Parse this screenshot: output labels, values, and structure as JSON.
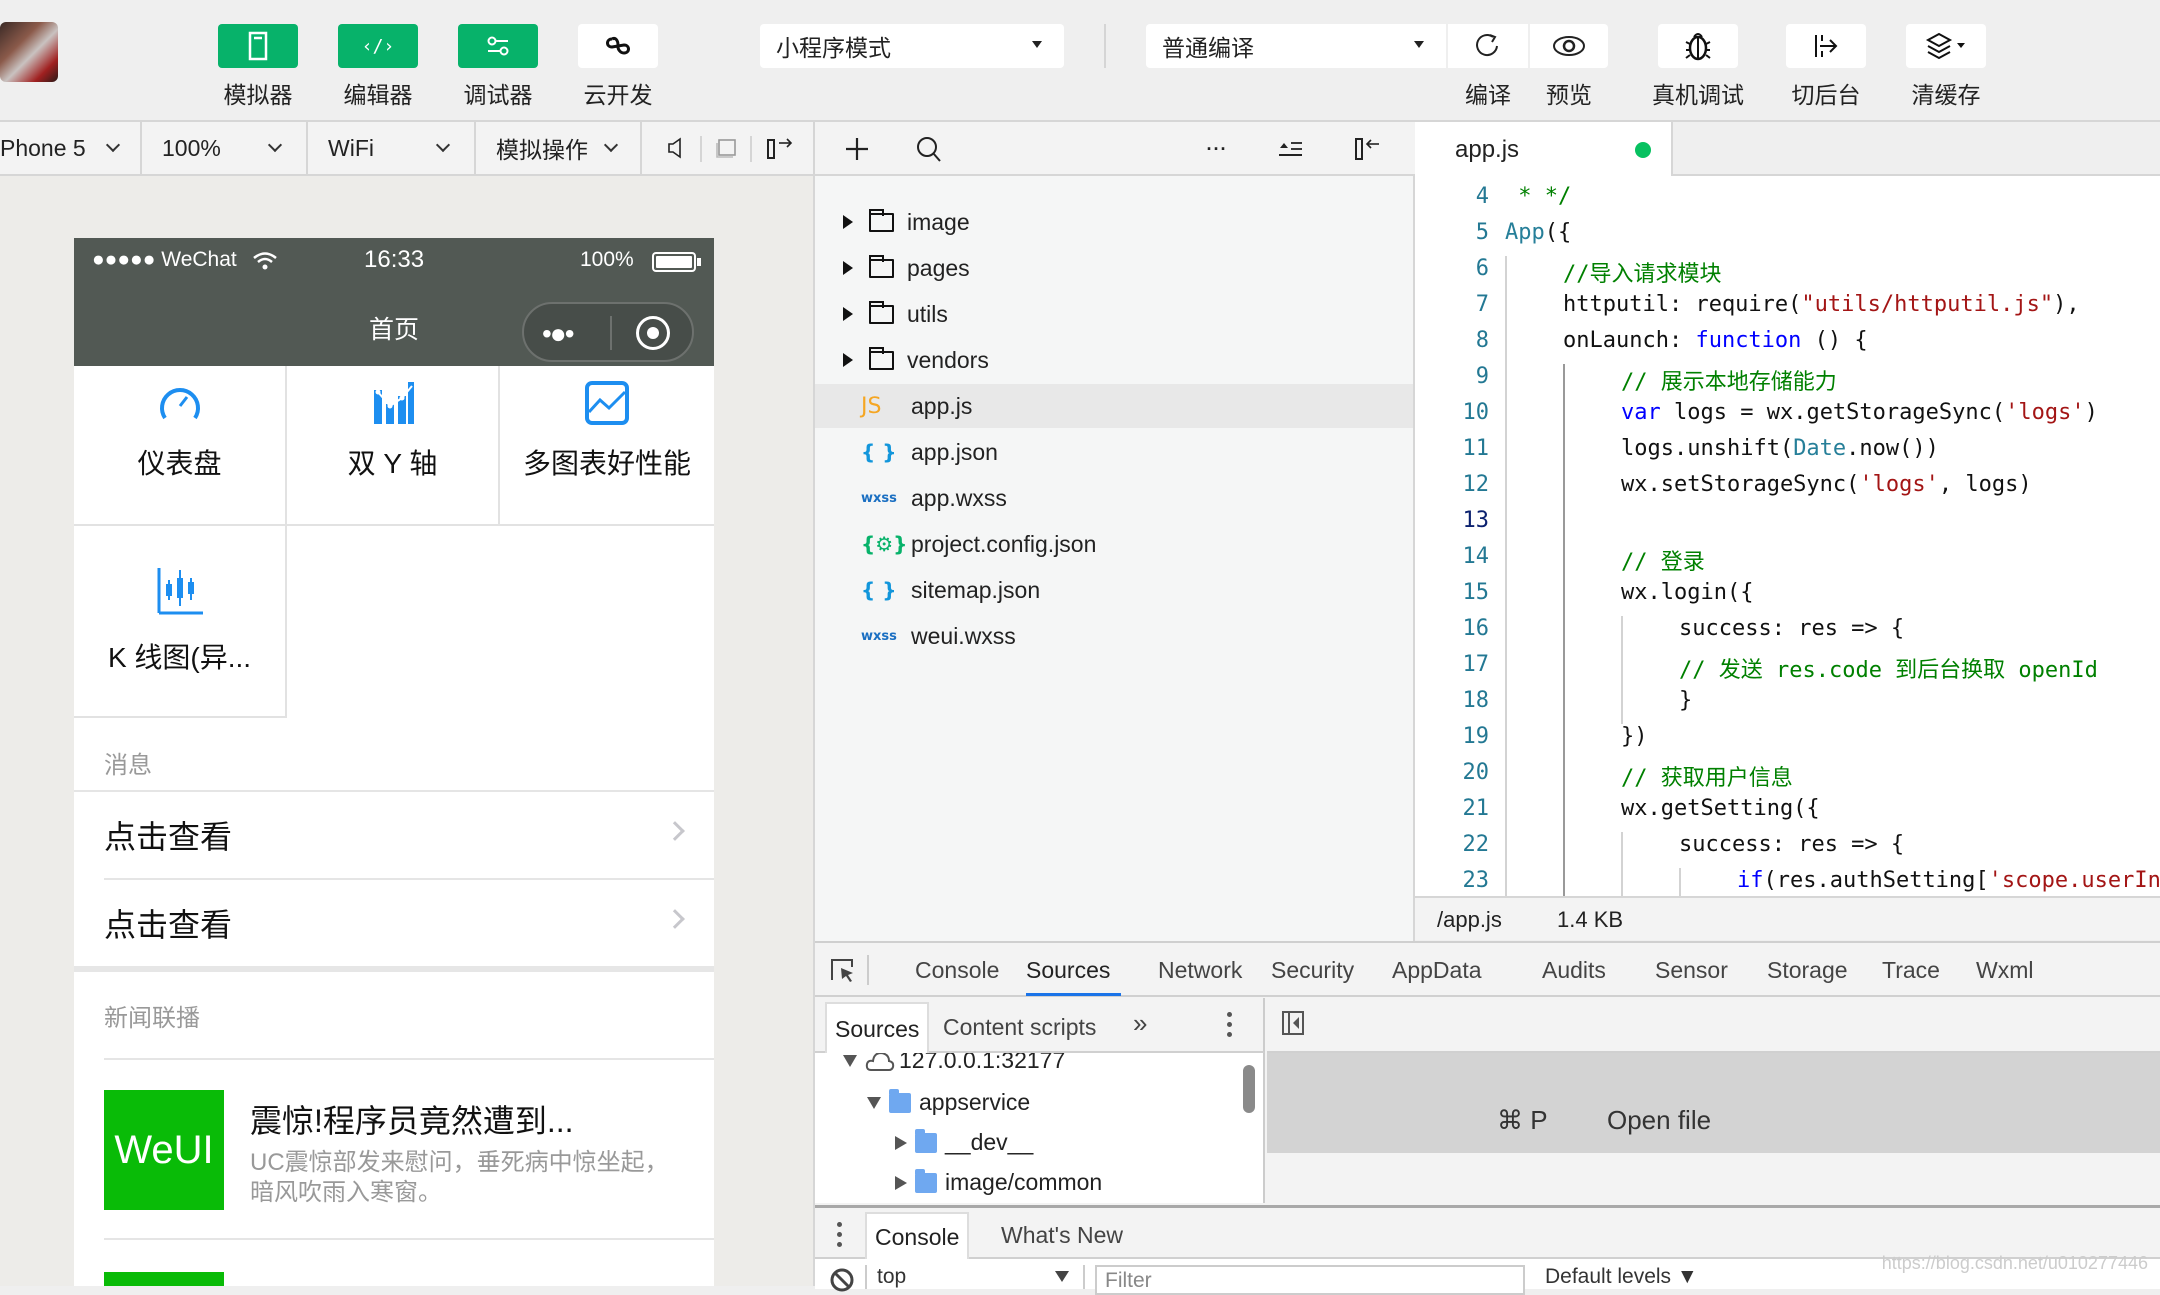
{
  "toolbar": {
    "left_buttons": [
      {
        "label": "模拟器",
        "icon": "phone-icon",
        "active": true
      },
      {
        "label": "编辑器",
        "icon": "code-icon",
        "active": true
      },
      {
        "label": "调试器",
        "icon": "debug-sliders-icon",
        "active": true
      },
      {
        "label": "云开发",
        "icon": "cloud-link-icon",
        "active": false
      }
    ],
    "mode_dropdown": "小程序模式",
    "compile_dropdown": "普通编译",
    "right_buttons": [
      {
        "label": "编译",
        "icon": "refresh-icon"
      },
      {
        "label": "预览",
        "icon": "eye-icon"
      },
      {
        "label": "真机调试",
        "icon": "bug-icon"
      },
      {
        "label": "切后台",
        "icon": "switch-background-icon"
      },
      {
        "label": "清缓存",
        "icon": "layers-icon"
      }
    ]
  },
  "simulator_toolbar": {
    "device": "Phone 5",
    "zoom": "100%",
    "network": "WiFi",
    "simulate_ops": "模拟操作"
  },
  "phone": {
    "status": {
      "carrier": "●●●●● WeChat",
      "time": "16:33",
      "battery": "100%"
    },
    "nav_title": "首页",
    "grid": [
      {
        "label": "仪表盘",
        "icon": "gauge-icon"
      },
      {
        "label": "双 Y 轴",
        "icon": "dual-axis-chart-icon"
      },
      {
        "label": "多图表好性能",
        "icon": "line-chart-icon"
      },
      {
        "label": "K 线图(异...",
        "icon": "candlestick-chart-icon"
      }
    ],
    "messages_title": "消息",
    "message_cells": [
      "点击查看",
      "点击查看"
    ],
    "news_title": "新闻联播",
    "news": [
      {
        "thumb": "WeUI",
        "title": "震惊!程序员竟然遭到...",
        "desc": "UC震惊部发来慰问，垂死病中惊坐起，暗风吹雨入寒窗。"
      }
    ]
  },
  "file_tree": {
    "items": [
      {
        "name": "image",
        "type": "folder"
      },
      {
        "name": "pages",
        "type": "folder"
      },
      {
        "name": "utils",
        "type": "folder"
      },
      {
        "name": "vendors",
        "type": "folder"
      },
      {
        "name": "app.js",
        "type": "js",
        "badge": "JS",
        "color": "#f5a623",
        "selected": true
      },
      {
        "name": "app.json",
        "type": "json",
        "badge": "{ }",
        "color": "#1296db"
      },
      {
        "name": "app.wxss",
        "type": "wxss",
        "badge": "wxss",
        "color": "#1a6fc2"
      },
      {
        "name": "project.config.json",
        "type": "config",
        "badge": "{⚙}",
        "color": "#07b26a"
      },
      {
        "name": "sitemap.json",
        "type": "json",
        "badge": "{ }",
        "color": "#1296db"
      },
      {
        "name": "weui.wxss",
        "type": "wxss",
        "badge": "wxss",
        "color": "#1a6fc2"
      }
    ]
  },
  "editor": {
    "tab": "app.js",
    "modified_dot_color": "#07c160",
    "current_line": 13,
    "lines": [
      {
        "n": 4,
        "indent": 0,
        "tokens": [
          {
            "t": " * */",
            "c": "cm"
          }
        ]
      },
      {
        "n": 5,
        "indent": 0,
        "tokens": [
          {
            "t": "App",
            "c": "ty"
          },
          {
            "t": "({",
            "c": ""
          }
        ]
      },
      {
        "n": 6,
        "indent": 1,
        "tokens": [
          {
            "t": "//导入请求模块",
            "c": "cm"
          }
        ]
      },
      {
        "n": 7,
        "indent": 1,
        "tokens": [
          {
            "t": "httputil: require(",
            "c": ""
          },
          {
            "t": "\"utils/httputil.js\"",
            "c": "str"
          },
          {
            "t": "),",
            "c": ""
          }
        ]
      },
      {
        "n": 8,
        "indent": 1,
        "tokens": [
          {
            "t": "onLaunch: ",
            "c": ""
          },
          {
            "t": "function",
            "c": "kw"
          },
          {
            "t": " () {",
            "c": ""
          }
        ]
      },
      {
        "n": 9,
        "indent": 2,
        "tokens": [
          {
            "t": "// 展示本地存储能力",
            "c": "cm"
          }
        ]
      },
      {
        "n": 10,
        "indent": 2,
        "tokens": [
          {
            "t": "var",
            "c": "kw"
          },
          {
            "t": " logs = wx.getStorageSync(",
            "c": ""
          },
          {
            "t": "'logs'",
            "c": "str"
          },
          {
            "t": ")",
            "c": ""
          }
        ]
      },
      {
        "n": 11,
        "indent": 2,
        "tokens": [
          {
            "t": "logs.unshift(",
            "c": ""
          },
          {
            "t": "Date",
            "c": "ty"
          },
          {
            "t": ".now())",
            "c": ""
          }
        ]
      },
      {
        "n": 12,
        "indent": 2,
        "tokens": [
          {
            "t": "wx.setStorageSync(",
            "c": ""
          },
          {
            "t": "'logs'",
            "c": "str"
          },
          {
            "t": ", logs)",
            "c": ""
          }
        ]
      },
      {
        "n": 13,
        "indent": 2,
        "tokens": []
      },
      {
        "n": 14,
        "indent": 2,
        "tokens": [
          {
            "t": "// 登录",
            "c": "cm"
          }
        ]
      },
      {
        "n": 15,
        "indent": 2,
        "tokens": [
          {
            "t": "wx.login({",
            "c": ""
          }
        ]
      },
      {
        "n": 16,
        "indent": 3,
        "tokens": [
          {
            "t": "success: res => {",
            "c": ""
          }
        ]
      },
      {
        "n": 17,
        "indent": 3,
        "tokens": [
          {
            "t": "// 发送 res.code 到后台换取 openId",
            "c": "cm"
          }
        ]
      },
      {
        "n": 18,
        "indent": 3,
        "tokens": [
          {
            "t": "}",
            "c": ""
          }
        ]
      },
      {
        "n": 19,
        "indent": 2,
        "tokens": [
          {
            "t": "})",
            "c": ""
          }
        ]
      },
      {
        "n": 20,
        "indent": 2,
        "tokens": [
          {
            "t": "// 获取用户信息",
            "c": "cm"
          }
        ]
      },
      {
        "n": 21,
        "indent": 2,
        "tokens": [
          {
            "t": "wx.getSetting({",
            "c": ""
          }
        ]
      },
      {
        "n": 22,
        "indent": 3,
        "tokens": [
          {
            "t": "success: res => {",
            "c": ""
          }
        ]
      },
      {
        "n": 23,
        "indent": 4,
        "tokens": [
          {
            "t": "if",
            "c": "kw"
          },
          {
            "t": "(res.authSetting[",
            "c": ""
          },
          {
            "t": "'scope.userInfo'",
            "c": "str"
          },
          {
            "t": "]) {",
            "c": ""
          }
        ]
      }
    ],
    "status_path": "/app.js",
    "status_size": "1.4 KB"
  },
  "devtools": {
    "tabs": [
      "Console",
      "Sources",
      "Network",
      "Security",
      "AppData",
      "Audits",
      "Sensor",
      "Storage",
      "Trace",
      "Wxml"
    ],
    "active_tab": "Sources",
    "sources_subtabs": [
      "Sources",
      "Content scripts"
    ],
    "more_label": "»",
    "source_tree": [
      {
        "label": "127.0.0.1:32177",
        "level": 0,
        "expanded": true,
        "kind": "cloud"
      },
      {
        "label": "appservice",
        "level": 1,
        "expanded": true,
        "kind": "folder"
      },
      {
        "label": "__dev__",
        "level": 2,
        "expanded": false,
        "kind": "folder"
      },
      {
        "label": "image/common",
        "level": 2,
        "expanded": false,
        "kind": "folder"
      }
    ],
    "open_file_shortcut": "⌘ P",
    "open_file_label": "Open file",
    "drawer_tabs": [
      "Console",
      "What's New"
    ],
    "context": "top",
    "filter_placeholder": "Filter",
    "levels": "Default levels ▼",
    "watermark": "https://blog.csdn.net/u010277446"
  }
}
